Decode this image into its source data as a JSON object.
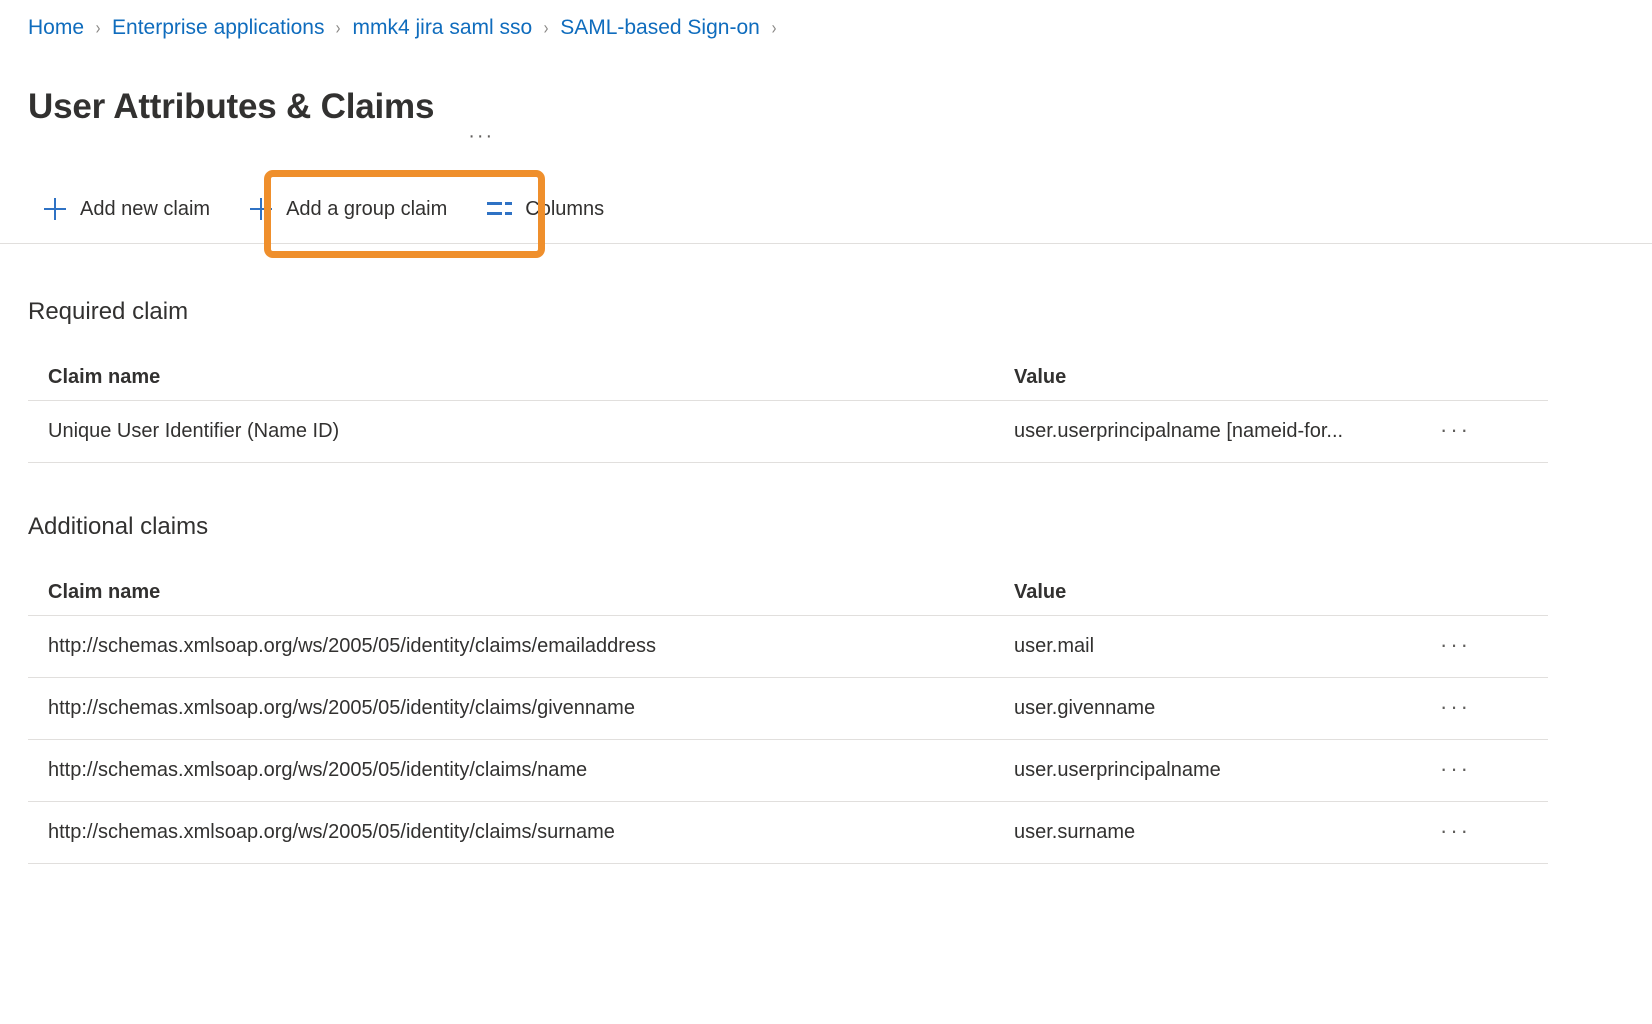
{
  "breadcrumb": {
    "separator": "›",
    "items": [
      {
        "label": "Home"
      },
      {
        "label": "Enterprise applications"
      },
      {
        "label": "mmk4 jira saml sso"
      },
      {
        "label": "SAML-based Sign-on"
      }
    ]
  },
  "header": {
    "title": "User Attributes & Claims",
    "more_label": "···"
  },
  "toolbar": {
    "add_new_claim_label": "Add new claim",
    "add_group_claim_label": "Add a group claim",
    "columns_label": "Columns",
    "highlight_color": "#ef8f2c",
    "icon_color": "#2f72c4"
  },
  "required_claim": {
    "section_title": "Required claim",
    "columns": [
      "Claim name",
      "Value"
    ],
    "rows": [
      {
        "claim_name": "Unique User Identifier (Name ID)",
        "value": "user.userprincipalname [nameid-for...",
        "menu_label": "···"
      }
    ]
  },
  "additional_claims": {
    "section_title": "Additional claims",
    "columns": [
      "Claim name",
      "Value"
    ],
    "rows": [
      {
        "claim_name": "http://schemas.xmlsoap.org/ws/2005/05/identity/claims/emailaddress",
        "value": "user.mail",
        "menu_label": "···"
      },
      {
        "claim_name": "http://schemas.xmlsoap.org/ws/2005/05/identity/claims/givenname",
        "value": "user.givenname",
        "menu_label": "···"
      },
      {
        "claim_name": "http://schemas.xmlsoap.org/ws/2005/05/identity/claims/name",
        "value": "user.userprincipalname",
        "menu_label": "···"
      },
      {
        "claim_name": "http://schemas.xmlsoap.org/ws/2005/05/identity/claims/surname",
        "value": "user.surname",
        "menu_label": "···"
      }
    ]
  }
}
